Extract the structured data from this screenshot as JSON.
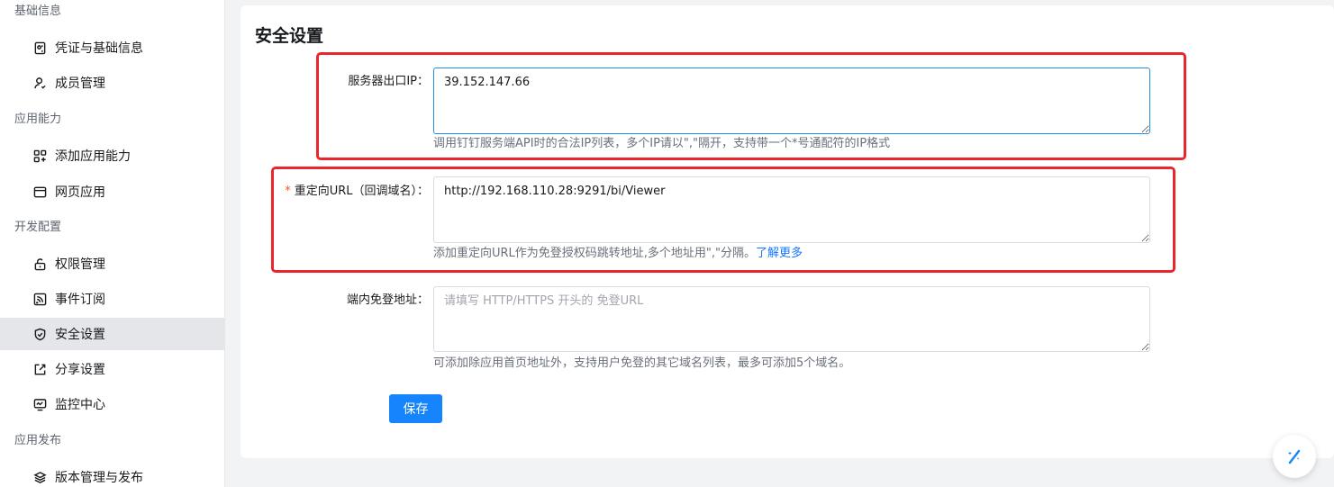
{
  "sidebar": {
    "groups": [
      {
        "title": "基础信息",
        "items": [
          {
            "label": "凭证与基础信息",
            "icon": "credential-icon"
          },
          {
            "label": "成员管理",
            "icon": "user-icon"
          }
        ]
      },
      {
        "title": "应用能力",
        "items": [
          {
            "label": "添加应用能力",
            "icon": "grid-add-icon"
          },
          {
            "label": "网页应用",
            "icon": "window-icon"
          }
        ]
      },
      {
        "title": "开发配置",
        "items": [
          {
            "label": "权限管理",
            "icon": "lock-icon"
          },
          {
            "label": "事件订阅",
            "icon": "subscribe-icon"
          },
          {
            "label": "安全设置",
            "icon": "shield-icon",
            "active": true
          },
          {
            "label": "分享设置",
            "icon": "share-icon"
          },
          {
            "label": "监控中心",
            "icon": "monitor-icon"
          }
        ]
      },
      {
        "title": "应用发布",
        "items": [
          {
            "label": "版本管理与发布",
            "icon": "layers-icon"
          }
        ]
      }
    ]
  },
  "main": {
    "title": "安全设置",
    "fields": {
      "server_ip": {
        "label": "服务器出口IP：",
        "value": "39.152.147.66",
        "help": "调用钉钉服务端API时的合法IP列表，多个IP请以\",\"隔开，支持带一个*号通配符的IP格式"
      },
      "redirect_url": {
        "required_mark": "*",
        "label": "重定向URL（回调域名）：",
        "value": "http://192.168.110.28:9291/bi/Viewer",
        "help": "添加重定向URL作为免登授权码跳转地址,多个地址用\",\"分隔。",
        "help_link": "了解更多"
      },
      "login_free": {
        "label": "端内免登地址：",
        "value": "",
        "placeholder": "请填写 HTTP/HTTPS 开头的 免登URL",
        "help": "可添加除应用首页地址外，支持用户免登的其它域名列表，最多可添加5个域名。"
      }
    },
    "save_label": "保存"
  },
  "colors": {
    "accent": "#1684fc",
    "highlight": "#e8262b",
    "active_nav": "#e5e6ea"
  }
}
